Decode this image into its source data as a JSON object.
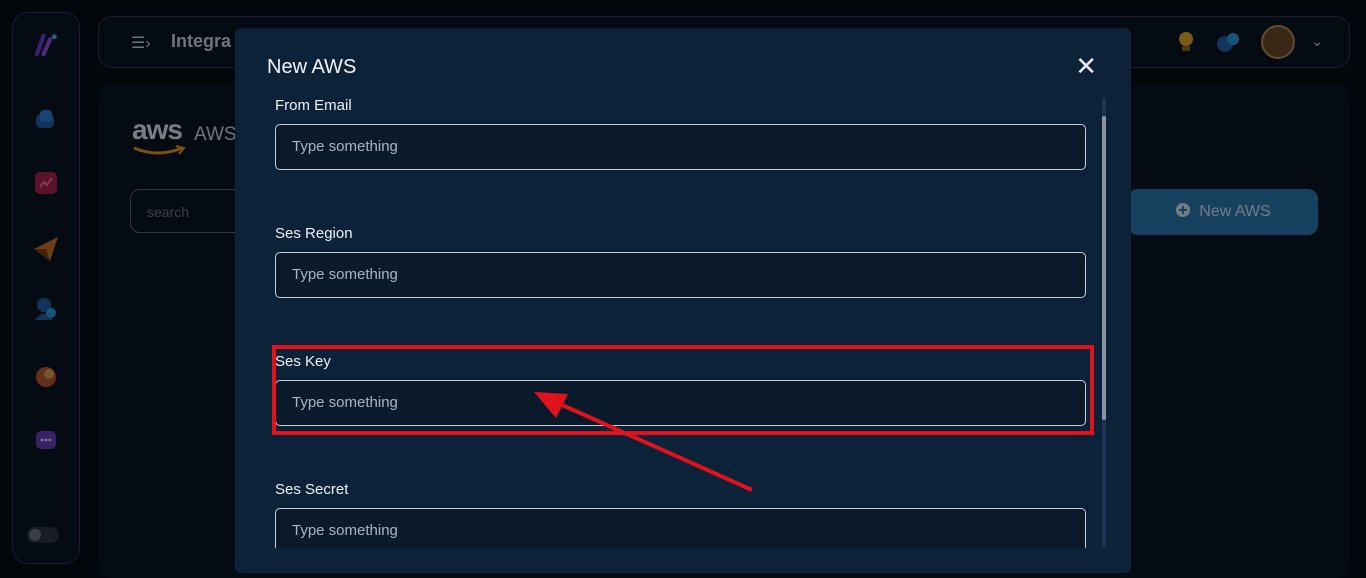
{
  "topbar": {
    "title": "Integra"
  },
  "page": {
    "service_name": "AWS",
    "logo_text": "aws"
  },
  "search": {
    "placeholder": "search"
  },
  "actions": {
    "new_button_label": "New AWS"
  },
  "modal": {
    "title": "New AWS",
    "fields": [
      {
        "label": "From Email",
        "placeholder": "Type something"
      },
      {
        "label": "Ses Region",
        "placeholder": "Type something"
      },
      {
        "label": "Ses Key",
        "placeholder": "Type something"
      },
      {
        "label": "Ses Secret",
        "placeholder": "Type something"
      }
    ]
  },
  "colors": {
    "accent": "#2978b0",
    "highlight": "#e0121c",
    "modal_bg": "#0c2238"
  },
  "icons": [
    "app-logo-icon",
    "home-icon",
    "analytics-icon",
    "send-icon",
    "users-icon",
    "integration-icon",
    "chat-icon",
    "menu-icon",
    "lightbulb-icon",
    "notification-icon",
    "chevron-down-icon",
    "close-icon",
    "add-circle-icon"
  ]
}
